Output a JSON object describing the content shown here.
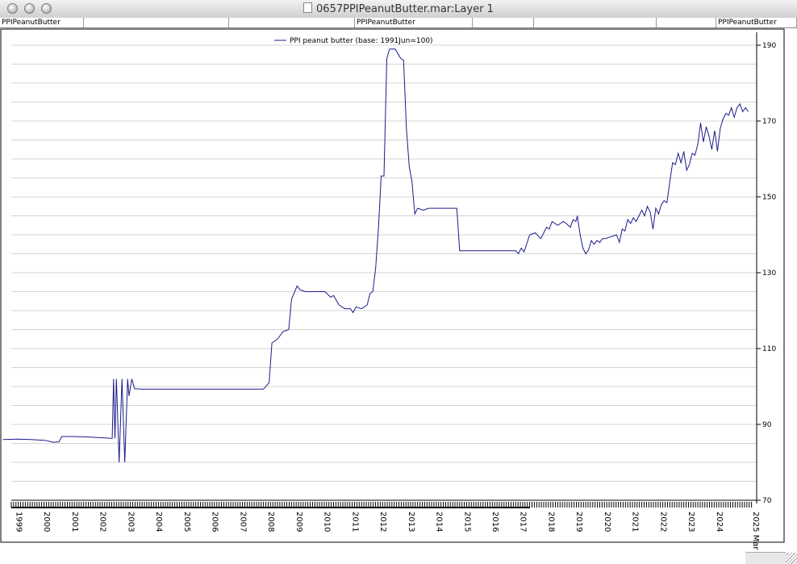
{
  "window": {
    "title": "0657PPIPeanutButter.mar:Layer 1",
    "tabs": [
      "PPIPeanutButter",
      "",
      "",
      "PPIPeanutButter",
      "",
      "",
      "",
      "PPIPeanutButter"
    ]
  },
  "chart_data": {
    "type": "line",
    "title": "",
    "xlabel": "",
    "ylabel": "",
    "ylim": [
      70,
      190
    ],
    "y_ticks": [
      70,
      90,
      110,
      130,
      150,
      170,
      190
    ],
    "x_tick_labels": [
      "1999",
      "2000",
      "2001",
      "2002",
      "2003",
      "2004",
      "2005",
      "2006",
      "2007",
      "2008",
      "2009",
      "2010",
      "2011",
      "2012",
      "2013",
      "2014",
      "2015",
      "2016",
      "2017",
      "2018",
      "2019",
      "2020",
      "2021",
      "2022",
      "2023",
      "2024",
      "2025 Mar"
    ],
    "grid": true,
    "legend_position": "top-center",
    "series": [
      {
        "name": "PPI peanut butter (base: 1991Jun=100)",
        "color": "#1c1c8c",
        "points": [
          [
            1998.5,
            86.0
          ],
          [
            1999.0,
            86.1
          ],
          [
            1999.5,
            86.0
          ],
          [
            2000.0,
            85.8
          ],
          [
            2000.3,
            85.3
          ],
          [
            2000.5,
            85.4
          ],
          [
            2000.6,
            86.8
          ],
          [
            2001.0,
            86.8
          ],
          [
            2001.5,
            86.7
          ],
          [
            2002.0,
            86.5
          ],
          [
            2002.2,
            86.4
          ],
          [
            2002.4,
            86.3
          ],
          [
            2002.45,
            102.0
          ],
          [
            2002.5,
            86.3
          ],
          [
            2002.55,
            102.0
          ],
          [
            2002.65,
            80.0
          ],
          [
            2002.75,
            102.0
          ],
          [
            2002.85,
            80.0
          ],
          [
            2002.95,
            102.0
          ],
          [
            2003.0,
            97.5
          ],
          [
            2003.1,
            102.0
          ],
          [
            2003.2,
            99.4
          ],
          [
            2003.5,
            99.3
          ],
          [
            2004.0,
            99.3
          ],
          [
            2005.0,
            99.3
          ],
          [
            2006.0,
            99.3
          ],
          [
            2007.0,
            99.3
          ],
          [
            2007.8,
            99.3
          ],
          [
            2008.0,
            101.0
          ],
          [
            2008.1,
            111.5
          ],
          [
            2008.3,
            112.5
          ],
          [
            2008.5,
            114.5
          ],
          [
            2008.7,
            115.0
          ],
          [
            2008.8,
            123.0
          ],
          [
            2009.0,
            126.5
          ],
          [
            2009.1,
            125.5
          ],
          [
            2009.3,
            125.0
          ],
          [
            2010.0,
            125.0
          ],
          [
            2010.2,
            123.5
          ],
          [
            2010.3,
            124.0
          ],
          [
            2010.5,
            121.5
          ],
          [
            2010.7,
            120.5
          ],
          [
            2010.9,
            120.5
          ],
          [
            2011.0,
            119.5
          ],
          [
            2011.1,
            121.0
          ],
          [
            2011.3,
            120.5
          ],
          [
            2011.5,
            121.5
          ],
          [
            2011.6,
            124.5
          ],
          [
            2011.7,
            125.0
          ],
          [
            2011.8,
            131.0
          ],
          [
            2011.9,
            141.5
          ],
          [
            2012.0,
            155.5
          ],
          [
            2012.1,
            155.5
          ],
          [
            2012.2,
            186.5
          ],
          [
            2012.3,
            189.0
          ],
          [
            2012.5,
            189.0
          ],
          [
            2012.7,
            186.5
          ],
          [
            2012.8,
            186.0
          ],
          [
            2012.9,
            168.0
          ],
          [
            2013.0,
            158.0
          ],
          [
            2013.1,
            154.0
          ],
          [
            2013.2,
            145.5
          ],
          [
            2013.3,
            147.0
          ],
          [
            2013.5,
            146.5
          ],
          [
            2013.7,
            147.0
          ],
          [
            2014.0,
            147.0
          ],
          [
            2014.5,
            147.0
          ],
          [
            2014.7,
            147.0
          ],
          [
            2014.8,
            135.8
          ],
          [
            2015.0,
            135.8
          ],
          [
            2015.5,
            135.8
          ],
          [
            2016.0,
            135.8
          ],
          [
            2016.5,
            135.8
          ],
          [
            2016.8,
            135.8
          ],
          [
            2016.9,
            135.0
          ],
          [
            2017.0,
            136.5
          ],
          [
            2017.1,
            135.5
          ],
          [
            2017.3,
            140.0
          ],
          [
            2017.5,
            140.5
          ],
          [
            2017.7,
            139.0
          ],
          [
            2017.9,
            142.0
          ],
          [
            2018.0,
            141.5
          ],
          [
            2018.1,
            143.5
          ],
          [
            2018.3,
            142.5
          ],
          [
            2018.5,
            143.5
          ],
          [
            2018.6,
            143.0
          ],
          [
            2018.75,
            142.0
          ],
          [
            2018.85,
            144.0
          ],
          [
            2018.95,
            143.5
          ],
          [
            2019.0,
            145.0
          ],
          [
            2019.1,
            140.0
          ],
          [
            2019.2,
            136.5
          ],
          [
            2019.3,
            135.0
          ],
          [
            2019.4,
            136.0
          ],
          [
            2019.5,
            138.5
          ],
          [
            2019.6,
            137.5
          ],
          [
            2019.7,
            138.5
          ],
          [
            2019.8,
            138.0
          ],
          [
            2019.9,
            139.0
          ],
          [
            2020.0,
            139.0
          ],
          [
            2020.2,
            139.5
          ],
          [
            2020.4,
            140.0
          ],
          [
            2020.5,
            138.0
          ],
          [
            2020.6,
            141.5
          ],
          [
            2020.7,
            141.0
          ],
          [
            2020.8,
            144.0
          ],
          [
            2020.9,
            143.0
          ],
          [
            2021.0,
            144.5
          ],
          [
            2021.1,
            143.5
          ],
          [
            2021.3,
            146.5
          ],
          [
            2021.4,
            145.0
          ],
          [
            2021.5,
            147.5
          ],
          [
            2021.6,
            146.0
          ],
          [
            2021.7,
            141.5
          ],
          [
            2021.8,
            147.0
          ],
          [
            2021.9,
            145.5
          ],
          [
            2022.0,
            148.0
          ],
          [
            2022.1,
            149.0
          ],
          [
            2022.2,
            148.5
          ],
          [
            2022.3,
            154.0
          ],
          [
            2022.4,
            159.0
          ],
          [
            2022.5,
            158.5
          ],
          [
            2022.6,
            161.5
          ],
          [
            2022.7,
            159.0
          ],
          [
            2022.8,
            162.0
          ],
          [
            2022.9,
            157.0
          ],
          [
            2023.0,
            158.5
          ],
          [
            2023.1,
            161.5
          ],
          [
            2023.2,
            161.0
          ],
          [
            2023.3,
            164.0
          ],
          [
            2023.4,
            169.5
          ],
          [
            2023.5,
            164.5
          ],
          [
            2023.6,
            168.5
          ],
          [
            2023.7,
            166.0
          ],
          [
            2023.8,
            162.5
          ],
          [
            2023.9,
            167.5
          ],
          [
            2024.0,
            162.0
          ],
          [
            2024.1,
            168.0
          ],
          [
            2024.2,
            170.5
          ],
          [
            2024.3,
            172.0
          ],
          [
            2024.4,
            171.5
          ],
          [
            2024.5,
            173.5
          ],
          [
            2024.6,
            171.0
          ],
          [
            2024.7,
            173.5
          ],
          [
            2024.8,
            174.5
          ],
          [
            2024.9,
            172.5
          ],
          [
            2025.0,
            173.5
          ],
          [
            2025.1,
            172.5
          ]
        ]
      }
    ]
  }
}
